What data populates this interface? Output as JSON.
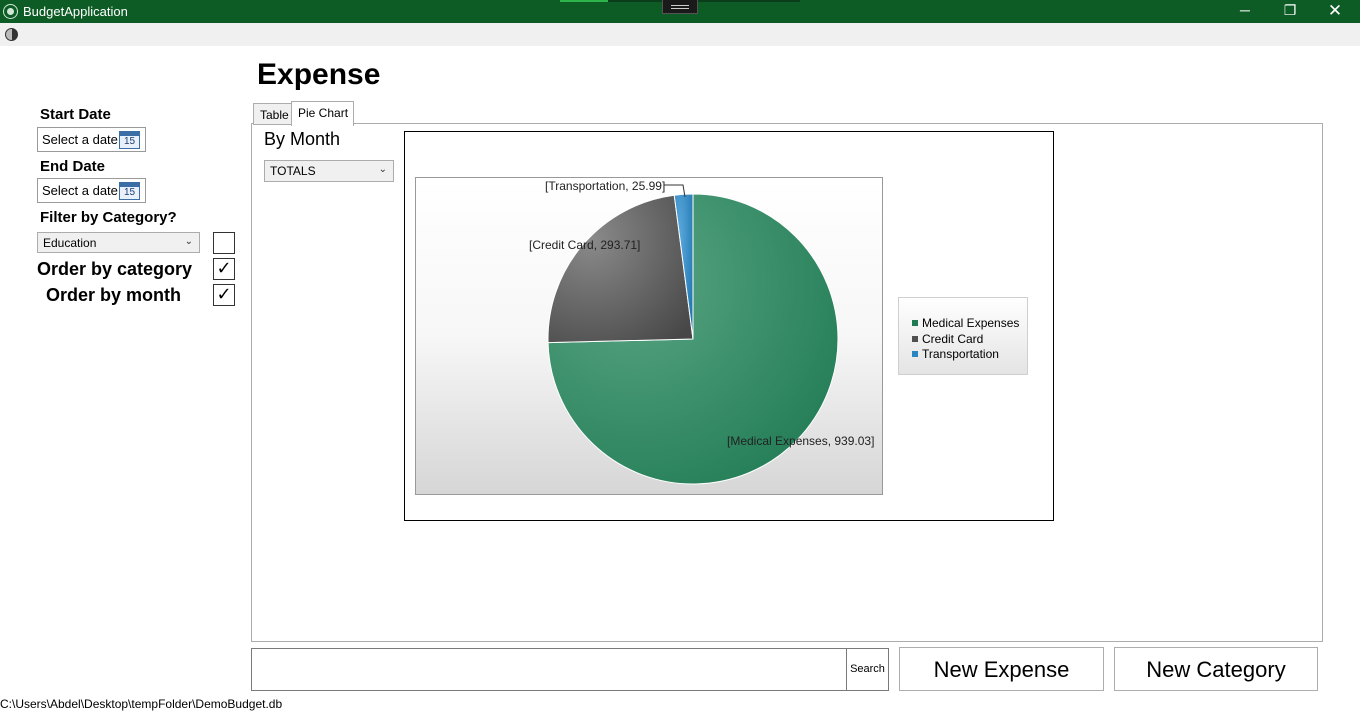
{
  "window": {
    "title": "BudgetApplication",
    "minimize_glyph": "─",
    "maximize_glyph": "❐",
    "close_glyph": "✕"
  },
  "filters": {
    "start_date_label": "Start Date",
    "start_date_placeholder": "Select a date",
    "end_date_label": "End Date",
    "end_date_placeholder": "Select a date",
    "calendar_icon_text": "15",
    "filter_category_label": "Filter by Category?",
    "category_selected": "Education",
    "filter_category_checked": false,
    "order_by_category_label": "Order by category",
    "order_by_category_checked": true,
    "order_by_month_label": "Order by month",
    "order_by_month_checked": true,
    "check_glyph": "✓"
  },
  "main": {
    "page_title": "Expense",
    "tabs": [
      {
        "label": "Table",
        "active": false
      },
      {
        "label": "Pie Chart",
        "active": true
      }
    ],
    "grouping_label": "By Month",
    "month_selected": "TOTALS"
  },
  "chart_data": {
    "type": "pie",
    "categories": [
      "Medical Expenses",
      "Credit Card",
      "Transportation"
    ],
    "values": [
      939.03,
      293.71,
      25.99
    ],
    "data_labels": [
      "[Medical Expenses, 939.03]",
      "[Credit Card, 293.71]",
      "[Transportation, 25.99]"
    ],
    "colors": [
      "#1e7a52",
      "#4f4f4f",
      "#2a86c0"
    ],
    "legend_position": "right"
  },
  "bottom": {
    "search_value": "",
    "search_button": "Search",
    "new_expense_button": "New Expense",
    "new_category_button": "New Category"
  },
  "status": {
    "db_path": "C:\\Users\\Abdel\\Desktop\\tempFolder\\DemoBudget.db"
  },
  "icons": [
    "app-icon",
    "theme-toggle-icon",
    "calendar-icon",
    "chevron-down-icon",
    "checkmark-icon"
  ]
}
